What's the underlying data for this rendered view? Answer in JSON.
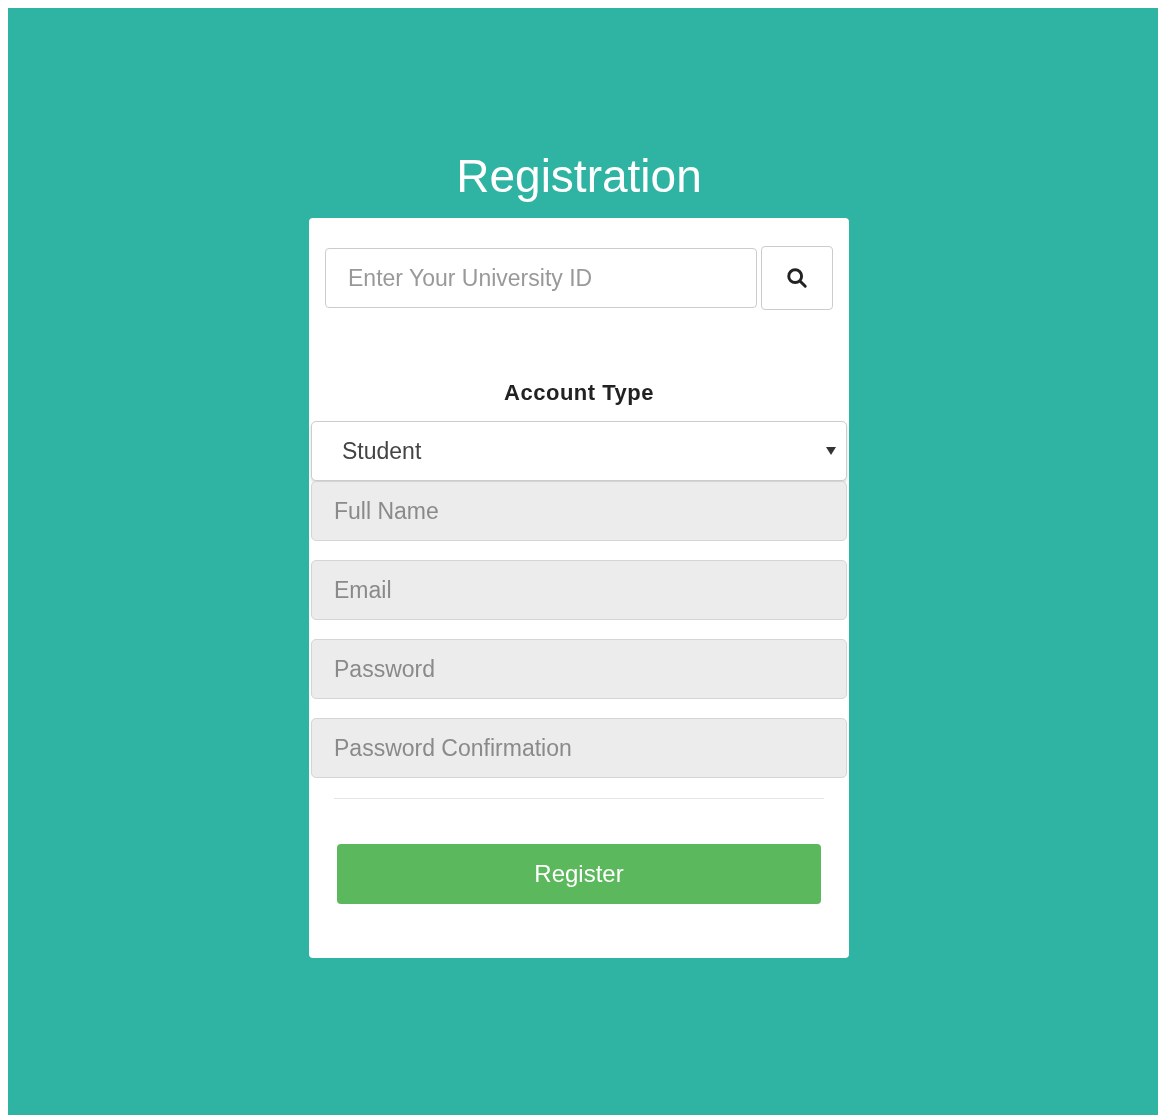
{
  "title": "Registration",
  "university_id": {
    "placeholder": "Enter Your University ID"
  },
  "account_type": {
    "label": "Account Type",
    "value": "Student"
  },
  "fields": [
    {
      "placeholder": "Full Name"
    },
    {
      "placeholder": "Email"
    },
    {
      "placeholder": "Password"
    },
    {
      "placeholder": "Password Confirmation"
    }
  ],
  "submit": {
    "label": "Register"
  }
}
